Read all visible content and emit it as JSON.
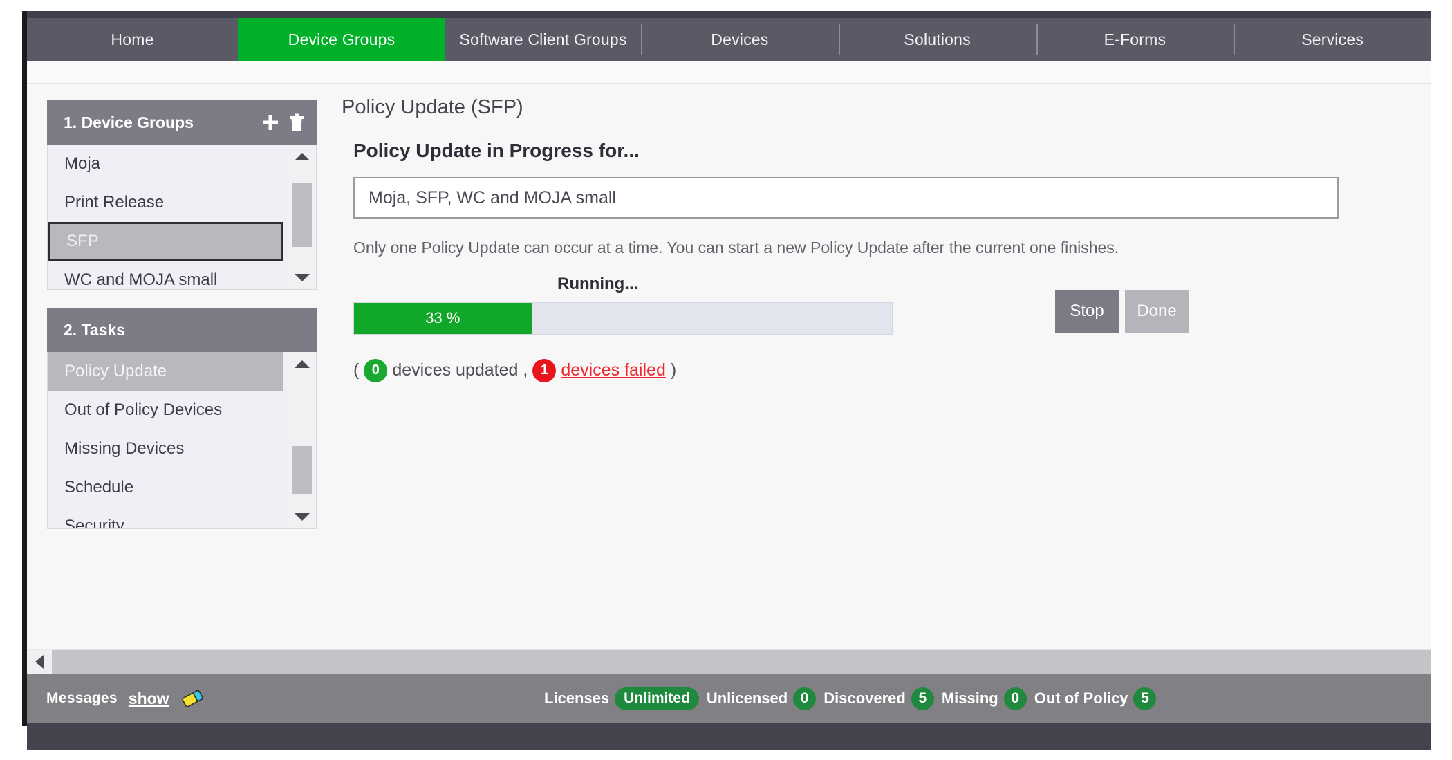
{
  "nav": {
    "items": [
      {
        "label": "Home",
        "active": false
      },
      {
        "label": "Device Groups",
        "active": true
      },
      {
        "label": "Software Client Groups",
        "active": false
      },
      {
        "label": "Devices",
        "active": false
      },
      {
        "label": "Solutions",
        "active": false
      },
      {
        "label": "E-Forms",
        "active": false
      },
      {
        "label": "Services",
        "active": false
      }
    ]
  },
  "sidebar": {
    "device_groups": {
      "title": "1. Device Groups",
      "add_icon": "plus-icon",
      "delete_icon": "trash-icon",
      "items": [
        {
          "label": "Moja",
          "selected": false
        },
        {
          "label": "Print Release",
          "selected": false
        },
        {
          "label": "SFP",
          "selected": true
        },
        {
          "label": "WC and MOJA small",
          "selected": false
        }
      ]
    },
    "tasks": {
      "title": "2. Tasks",
      "items": [
        {
          "label": "Policy Update",
          "selected": true
        },
        {
          "label": "Out of Policy Devices",
          "selected": false
        },
        {
          "label": "Missing Devices",
          "selected": false
        },
        {
          "label": "Schedule",
          "selected": false
        },
        {
          "label": "Security",
          "selected": false
        }
      ]
    }
  },
  "main": {
    "page_title": "Policy Update (SFP)",
    "section_title": "Policy Update in Progress for...",
    "target_value": "Moja, SFP, WC and MOJA small",
    "hint": "Only one Policy Update can occur at a time. You can start a new Policy Update after the current one finishes.",
    "progress": {
      "status_label": "Running...",
      "percent_label": "33 %",
      "percent": 33
    },
    "buttons": {
      "stop": "Stop",
      "done": "Done"
    },
    "counts": {
      "open_paren": "(",
      "updated_count": "0",
      "updated_label": "devices updated",
      "comma": ",",
      "failed_count": "1",
      "failed_label": "devices failed",
      "close_paren": ")"
    }
  },
  "statusbar": {
    "messages_label": "Messages",
    "show_label": "show",
    "clear_icon": "eraser-icon",
    "stats": [
      {
        "label": "Licenses",
        "value": "Unlimited"
      },
      {
        "label": "Unlicensed",
        "value": "0"
      },
      {
        "label": "Discovered",
        "value": "5"
      },
      {
        "label": "Missing",
        "value": "0"
      },
      {
        "label": "Out of Policy",
        "value": "5"
      }
    ]
  },
  "colors": {
    "accent_green": "#00b028",
    "progress_green": "#11a82a",
    "fail_red": "#f0262c",
    "nav_gray": "#5a5a66"
  }
}
